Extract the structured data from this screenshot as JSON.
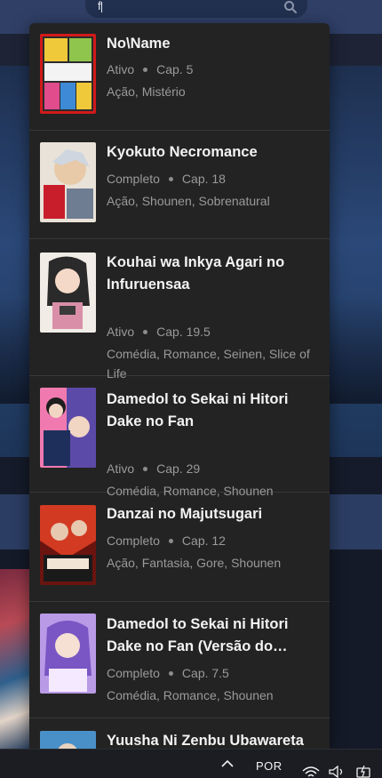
{
  "search": {
    "value": "f",
    "placeholder": ""
  },
  "taskbar": {
    "language": "POR"
  },
  "results": [
    {
      "title": "No\\Name",
      "status": "Ativo",
      "chapter": "Cap. 5",
      "genres": "Ação, Mistério",
      "cover_colors": [
        "#d11a1a",
        "#f0c93a",
        "#2b2b2b"
      ]
    },
    {
      "title": "Kyokuto Necromance",
      "status": "Completo",
      "chapter": "Cap. 18",
      "genres": "Ação, Shounen, Sobrenatural",
      "cover_colors": [
        "#e9e2d8",
        "#c81d2a",
        "#6f7d92"
      ]
    },
    {
      "title": "Kouhai wa Inkya Agari no Infuruensaa",
      "status": "Ativo",
      "chapter": "Cap. 19.5",
      "genres": "Comédia, Romance, Seinen, Slice of Life",
      "cover_colors": [
        "#f1ece6",
        "#2a2a2a",
        "#d98fa8"
      ]
    },
    {
      "title": "Damedol to Sekai ni Hitori Dake no Fan",
      "status": "Ativo",
      "chapter": "Cap. 29",
      "genres": "Comédia, Romance, Shounen",
      "cover_colors": [
        "#f07ab0",
        "#5c4aa8",
        "#1e1e1e"
      ]
    },
    {
      "title": "Danzai no Majutsugari",
      "status": "Completo",
      "chapter": "Cap. 12",
      "genres": "Ação, Fantasia, Gore, Shounen",
      "cover_colors": [
        "#6a1410",
        "#d23a22",
        "#1a1a1a"
      ]
    },
    {
      "title": "Damedol to Sekai ni Hitori Dake no Fan (Versão do…",
      "status": "Completo",
      "chapter": "Cap. 7.5",
      "genres": "Comédia, Romance, Shounen",
      "cover_colors": [
        "#b99ae6",
        "#7a55c4",
        "#f4e9ff"
      ]
    },
    {
      "title": "Yuusha Ni Zenbu Ubawareta",
      "status": "",
      "chapter": "",
      "genres": "",
      "cover_colors": [
        "#4a90c8",
        "#e8d2c0",
        "#2a2a2a"
      ]
    }
  ]
}
